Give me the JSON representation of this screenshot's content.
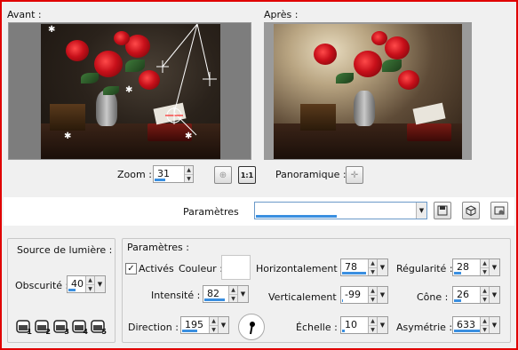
{
  "preview": {
    "before_label": "Avant :",
    "after_label": "Après :"
  },
  "zoom": {
    "label": "Zoom :",
    "value": "31",
    "fraction": 0.35,
    "one_to_one_label": "1:1"
  },
  "pan": {
    "label": "Panoramique :"
  },
  "presets": {
    "label": "Paramètres",
    "value": ""
  },
  "light_sources": {
    "title": "Source de lumière :",
    "obscurity_label": "Obscurité :",
    "obscurity_value": "40",
    "obscurity_fraction": 0.4,
    "source_numbers": [
      "1",
      "2",
      "3",
      "4",
      "5"
    ]
  },
  "params": {
    "title": "Paramètres :",
    "active_label": "Activés",
    "active_checked": true,
    "color_label": "Couleur :",
    "color_value": "#ffffff",
    "intensity_label": "Intensité :",
    "intensity_value": "82",
    "intensity_fraction": 0.82,
    "direction_label": "Direction :",
    "direction_value": "195",
    "direction_fraction": 0.54,
    "horizontal_label": "Horizontalement :",
    "horizontal_value": "78",
    "horizontal_fraction": 0.89,
    "vertical_label": "Verticalement :",
    "vertical_value": "-99",
    "vertical_fraction": 0.01,
    "scale_label": "Échelle :",
    "scale_value": "10",
    "scale_fraction": 0.1,
    "regularity_label": "Régularité :",
    "regularity_value": "28",
    "regularity_fraction": 0.28,
    "cone_label": "Cône :",
    "cone_value": "26",
    "cone_fraction": 0.26,
    "asymmetry_label": "Asymétrie :",
    "asymmetry_value": "633",
    "asymmetry_fraction": 0.95
  },
  "colors": {
    "frame_border": "#e00000",
    "accent_bar": "#3a8fe0"
  }
}
